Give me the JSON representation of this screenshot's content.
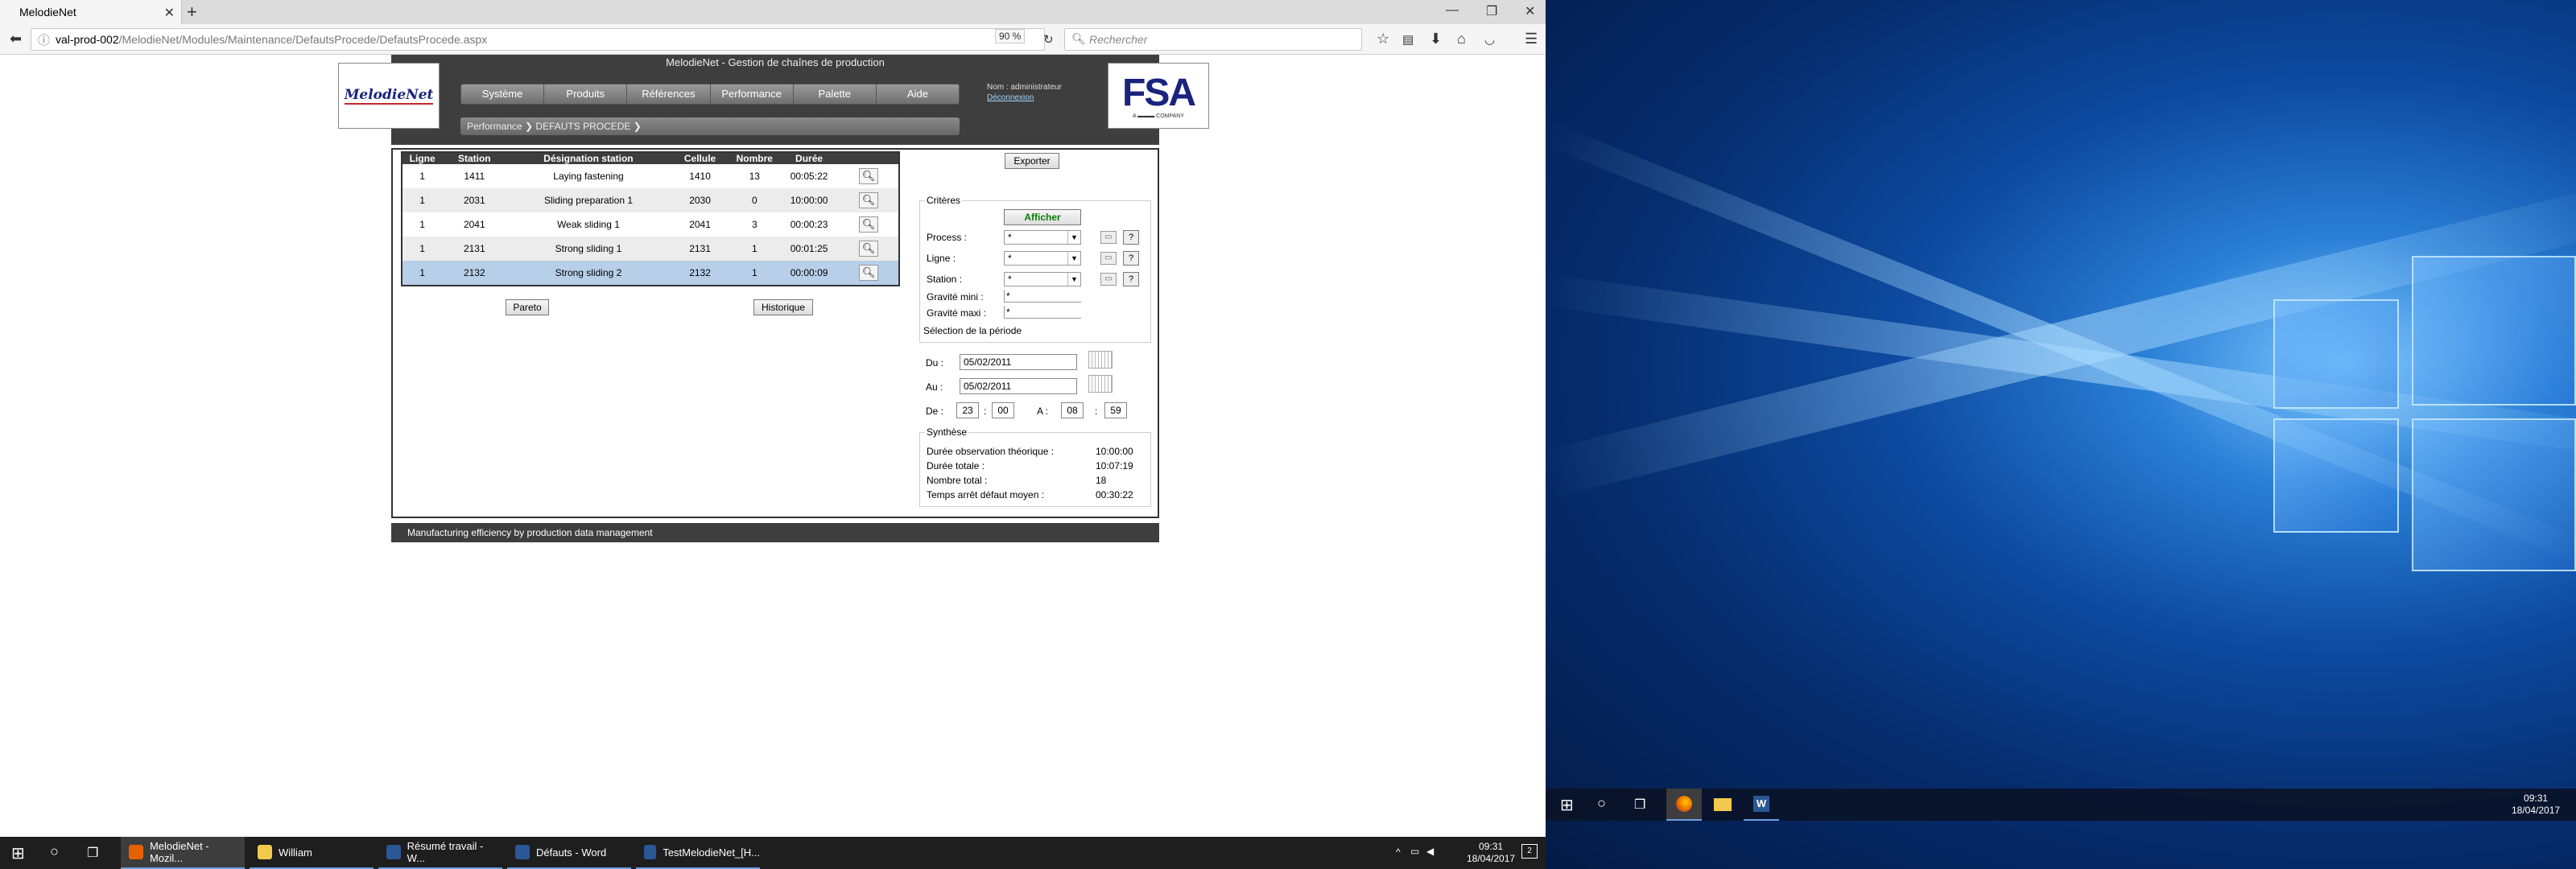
{
  "browser": {
    "tab_title": "MelodieNet",
    "url_host": "val-prod-002",
    "url_path": "/MelodieNet/Modules/Maintenance/DefautsProcede/DefautsProcede.aspx",
    "zoom": "90 %",
    "search_placeholder": "Rechercher"
  },
  "app": {
    "title": "MelodieNet - Gestion de chaînes de production",
    "logo_left": "MelodieNet",
    "logo_right": "FSA",
    "logo_right_sub": "A ▬▬▬ COMPANY",
    "menu": [
      "Système",
      "Produits",
      "Références",
      "Performance",
      "Palette",
      "Aide"
    ],
    "user": "Nom : administrateur",
    "logout": "Déconnexion",
    "breadcrumb": "Performance ❯ DEFAUTS PROCEDE ❯",
    "footer": "Manufacturing efficiency by production data management"
  },
  "grid": {
    "headers": [
      "Ligne",
      "Station",
      "Désignation station",
      "Cellule",
      "Nombre",
      "Durée"
    ],
    "rows": [
      {
        "ligne": "1",
        "station": "1411",
        "designation": "Laying fastening",
        "cellule": "1410",
        "nombre": "13",
        "duree": "00:05:22"
      },
      {
        "ligne": "1",
        "station": "2031",
        "designation": "Sliding preparation 1",
        "cellule": "2030",
        "nombre": "0",
        "duree": "10:00:00"
      },
      {
        "ligne": "1",
        "station": "2041",
        "designation": "Weak sliding 1",
        "cellule": "2041",
        "nombre": "3",
        "duree": "00:00:23"
      },
      {
        "ligne": "1",
        "station": "2131",
        "designation": "Strong sliding 1",
        "cellule": "2131",
        "nombre": "1",
        "duree": "00:01:25"
      },
      {
        "ligne": "1",
        "station": "2132",
        "designation": "Strong sliding 2",
        "cellule": "2132",
        "nombre": "1",
        "duree": "00:00:09"
      }
    ],
    "pareto_label": "Pareto",
    "historique_label": "Historique"
  },
  "criteria": {
    "export_label": "Exporter",
    "legend": "Critères",
    "afficher_label": "Afficher",
    "process_label": "Process :",
    "process_value": "*",
    "ligne_label": "Ligne :",
    "ligne_value": "*",
    "station_label": "Station :",
    "station_value": "*",
    "gravite_mini_label": "Gravité mini :",
    "gravite_mini_value": "*",
    "gravite_maxi_label": "Gravité maxi :",
    "gravite_maxi_value": "*",
    "help_label": "?",
    "periode_label": "Sélection de la période",
    "du_label": "Du :",
    "du_value": "05/02/2011",
    "au_label": "Au :",
    "au_value": "05/02/2011",
    "de_label": "De :",
    "de_h": "23",
    "de_m": "00",
    "a_label": "A :",
    "a_h": "08",
    "a_m": "59",
    "sep": ":"
  },
  "synthese": {
    "legend": "Synthèse",
    "rows": [
      {
        "label": "Durée observation théorique :",
        "value": "10:00:00"
      },
      {
        "label": "Durée totale :",
        "value": "10:07:19"
      },
      {
        "label": "Nombre total :",
        "value": "18"
      },
      {
        "label": "Temps arrêt défaut moyen :",
        "value": "00:30:22"
      }
    ]
  },
  "taskbar": {
    "apps": [
      {
        "label": "MelodieNet - Mozil...",
        "color": "#e66000"
      },
      {
        "label": "William",
        "color": "#f2c94c"
      },
      {
        "label": "Résumé travail - W...",
        "color": "#2b5797"
      },
      {
        "label": "Défauts - Word",
        "color": "#2b5797"
      },
      {
        "label": "TestMelodieNet_[H...",
        "color": "#2b5797"
      }
    ],
    "time1": "09:31",
    "date1": "18/04/2017",
    "time2": "09:31",
    "date2": "18/04/2017",
    "notif_count": "2"
  }
}
